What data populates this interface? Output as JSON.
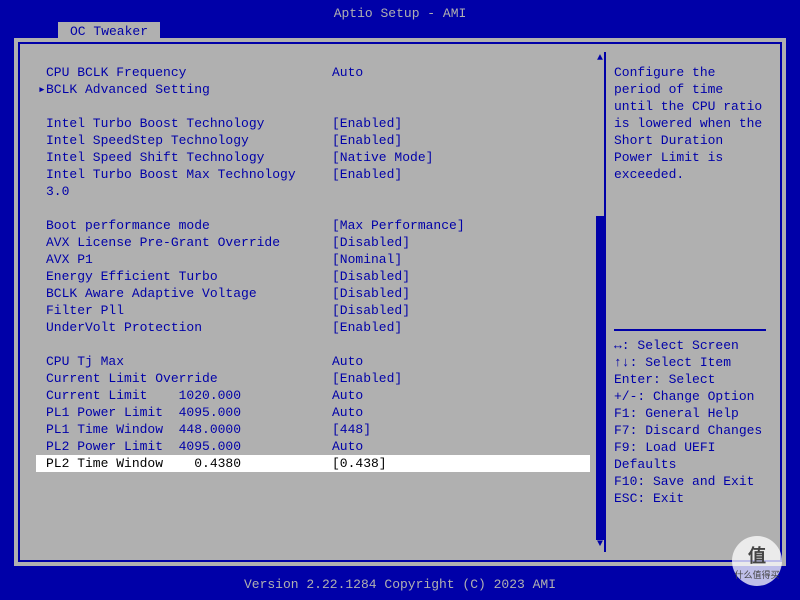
{
  "title": "Aptio Setup - AMI",
  "tab": "OC Tweaker",
  "footer": "Version 2.22.1284 Copyright (C) 2023 AMI",
  "rows": [
    {
      "type": "item",
      "label": "CPU BCLK Frequency",
      "value": "Auto"
    },
    {
      "type": "submenu",
      "label": "BCLK Advanced Setting",
      "value": ""
    },
    {
      "type": "blank"
    },
    {
      "type": "item",
      "label": "Intel Turbo Boost Technology",
      "value": "[Enabled]"
    },
    {
      "type": "item",
      "label": "Intel SpeedStep Technology",
      "value": "[Enabled]"
    },
    {
      "type": "item",
      "label": "Intel Speed Shift Technology",
      "value": "[Native Mode]"
    },
    {
      "type": "item",
      "label": "Intel Turbo Boost Max Technology 3.0",
      "value": "[Enabled]",
      "wrap": true
    },
    {
      "type": "blank"
    },
    {
      "type": "item",
      "label": "Boot performance mode",
      "value": "[Max Performance]"
    },
    {
      "type": "item",
      "label": "AVX License Pre-Grant Override",
      "value": "[Disabled]"
    },
    {
      "type": "item",
      "label": "AVX P1",
      "value": "[Nominal]"
    },
    {
      "type": "item",
      "label": "Energy Efficient Turbo",
      "value": "[Disabled]"
    },
    {
      "type": "item",
      "label": "BCLK Aware Adaptive Voltage",
      "value": "[Disabled]"
    },
    {
      "type": "item",
      "label": "Filter Pll",
      "value": "[Disabled]"
    },
    {
      "type": "item",
      "label": "UnderVolt Protection",
      "value": "[Enabled]"
    },
    {
      "type": "blank"
    },
    {
      "type": "item",
      "label": "CPU Tj Max",
      "value": "Auto"
    },
    {
      "type": "item",
      "label": "Current Limit Override",
      "value": "[Enabled]"
    },
    {
      "type": "item",
      "label": "Current Limit    1020.000",
      "value": "Auto"
    },
    {
      "type": "item",
      "label": "PL1 Power Limit  4095.000",
      "value": "Auto"
    },
    {
      "type": "item",
      "label": "PL1 Time Window  448.0000",
      "value": "[448]"
    },
    {
      "type": "item",
      "label": "PL2 Power Limit  4095.000",
      "value": "Auto"
    },
    {
      "type": "item",
      "label": "PL2 Time Window    0.4380",
      "value": "[0.438]",
      "selected": true
    }
  ],
  "help": {
    "description": "Configure the period of time until the CPU ratio is lowered when the Short Duration Power Limit is exceeded.",
    "keys": [
      "↔: Select Screen",
      "↑↓: Select Item",
      "Enter: Select",
      "+/-: Change Option",
      "F1: General Help",
      "F7: Discard Changes",
      "F9: Load UEFI Defaults",
      "F10: Save and Exit",
      "ESC: Exit"
    ]
  },
  "watermark": {
    "big": "值",
    "small": "什么值得买"
  }
}
